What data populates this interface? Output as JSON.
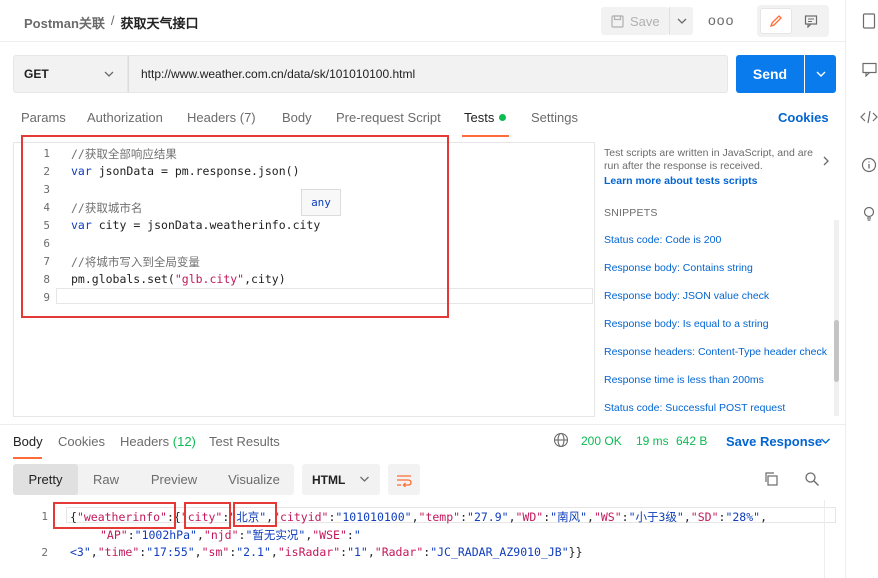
{
  "header": {
    "workspace": "Postman关联",
    "separator": "/",
    "request_name": "获取天气接口",
    "save_label": "Save",
    "more_label": "ooo"
  },
  "request": {
    "method": "GET",
    "url": "http://www.weather.com.cn/data/sk/101010100.html",
    "send_label": "Send"
  },
  "tabs": [
    {
      "label": "Params"
    },
    {
      "label": "Authorization"
    },
    {
      "label": "Headers (7)"
    },
    {
      "label": "Body"
    },
    {
      "label": "Pre-request Script"
    },
    {
      "label": "Tests"
    },
    {
      "label": "Settings"
    }
  ],
  "cookies_label": "Cookies",
  "editor": {
    "line_numbers": [
      "1",
      "2",
      "3",
      "4",
      "5",
      "6",
      "7",
      "8",
      "9"
    ],
    "lines": [
      {
        "cm": "//获取全部响应结果"
      },
      {
        "kw": "var",
        "rest": " jsonData = pm.response.json()"
      },
      {},
      {
        "cm": "//获取城市名"
      },
      {
        "kw": "var",
        "rest": " city = jsonData.weatherinfo.city"
      },
      {},
      {
        "cm": "//将城市写入到全局变量"
      },
      {
        "pre": "pm.globals.set(",
        "str": "\"glb.city\"",
        "post": ",city)"
      },
      {}
    ],
    "tooltip": "any"
  },
  "snippets": {
    "info": "Test scripts are written in JavaScript, and are run after the response is received.",
    "learn": "Learn more about tests scripts",
    "title": "SNIPPETS",
    "items": [
      "Status code: Code is 200",
      "Response body: Contains string",
      "Response body: JSON value check",
      "Response body: Is equal to a string",
      "Response headers: Content-Type header check",
      "Response time is less than 200ms",
      "Status code: Successful POST request"
    ]
  },
  "response": {
    "tabs": {
      "body": "Body",
      "cookies": "Cookies",
      "headers": "Headers",
      "headers_count": "(12)",
      "test_results": "Test Results"
    },
    "status": "200 OK",
    "time": "19 ms",
    "size": "642 B",
    "save_response": "Save Response",
    "views": [
      "Pretty",
      "Raw",
      "Preview",
      "Visualize"
    ],
    "format": "HTML",
    "line_numbers": [
      "1",
      "2"
    ]
  },
  "colors": {
    "accent": "#ff6c37",
    "send": "#097bed",
    "ok": "#0cbb52",
    "link": "#0265d2",
    "highlight_box": "#e53935"
  }
}
